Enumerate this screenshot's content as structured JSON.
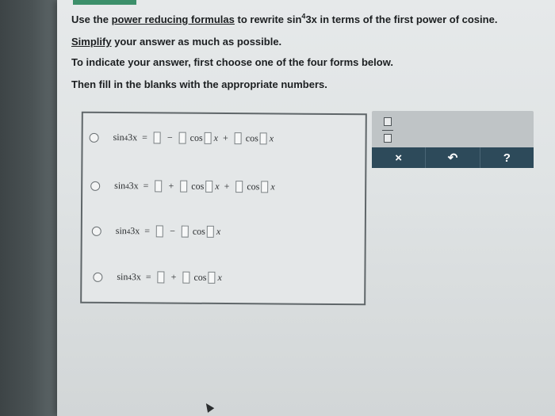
{
  "instructions": {
    "line1_pre": "Use the ",
    "line1_link": "power reducing formulas",
    "line1_mid": " to rewrite sin",
    "line1_exp": "4",
    "line1_post": "3x in terms of the first power of cosine.",
    "line2_link": "Simplify",
    "line2_post": " your answer as much as possible.",
    "line3": "To indicate your answer, first choose one of the four forms below.",
    "line4": "Then fill in the blanks with the appropriate numbers."
  },
  "forms": {
    "sin": "sin",
    "exp": "4",
    "arg": "3x",
    "eq": "=",
    "minus": "−",
    "plus": "+",
    "cos": "cos",
    "x": "x"
  },
  "toolbar": {
    "clear": "×",
    "undo": "↶",
    "help": "?"
  },
  "colors": {
    "toolbar_button": "#2d4a5a",
    "screen_bg": "#e2e5e6"
  }
}
